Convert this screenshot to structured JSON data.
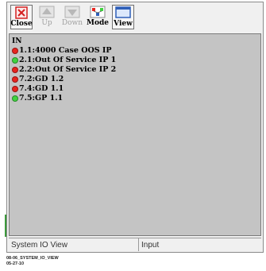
{
  "toolbar": {
    "buttons": [
      {
        "label": "Close",
        "icon": "close-icon",
        "enabled": true
      },
      {
        "label": "Up",
        "icon": "up-arrow-icon",
        "enabled": false
      },
      {
        "label": "Down",
        "icon": "down-arrow-icon",
        "enabled": false
      },
      {
        "label": "Mode",
        "icon": "mode-icon",
        "enabled": true
      },
      {
        "label": "View",
        "icon": "view-icon",
        "enabled": true
      }
    ]
  },
  "tree": {
    "root_label": "IN",
    "items": [
      {
        "label": "1.1:4000 Case OOS IP",
        "status_color": "#e8231e"
      },
      {
        "label": "2.1:Out Of Service IP 1",
        "status_color": "#3fd33f"
      },
      {
        "label": "2.2:Out Of Service IP 2",
        "status_color": "#e8231e"
      },
      {
        "label": "7.2:GD 1.2",
        "status_color": "#e8231e"
      },
      {
        "label": "7.4:GD 1.1",
        "status_color": "#e8231e"
      },
      {
        "label": "7.5:GP 1.1",
        "status_color": "#3fd33f"
      }
    ]
  },
  "status_bar": {
    "view_name": "System IO View",
    "mode": "Input"
  },
  "caption": {
    "line1": "08-06_SYSTEM_IO_VIEW",
    "line2": "05-27-10"
  },
  "colors": {
    "panel_background": "#c4c4c4",
    "status_red": "#e8231e",
    "status_green": "#3fd33f",
    "close_icon": "#d42020",
    "view_icon": "#2f5fb8"
  }
}
